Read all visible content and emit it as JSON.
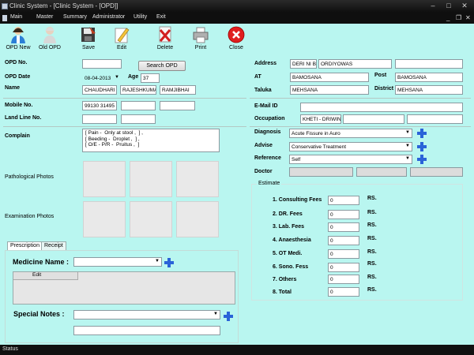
{
  "window": {
    "title": "Clinic System - [Clinic System - [OPD]]",
    "controls": {
      "minimize": "–",
      "maximize": "□",
      "close": "✕"
    },
    "mdi_controls": {
      "minimize": "_",
      "restore": "❒",
      "close": "✕"
    }
  },
  "menu": [
    "Main",
    "Master",
    "Summary",
    "Administrator",
    "Utility",
    "Exit"
  ],
  "toolbar": [
    {
      "label": "OPD New",
      "icon": "person-add-icon"
    },
    {
      "label": "Old OPD",
      "icon": "old-person-icon"
    },
    {
      "label": "Save",
      "icon": "save-icon"
    },
    {
      "label": "Edit",
      "icon": "edit-pencil-icon"
    },
    {
      "label": "Delete",
      "icon": "delete-document-icon"
    },
    {
      "label": "Print",
      "icon": "printer-icon"
    },
    {
      "label": "Close",
      "icon": "close-circle-icon"
    }
  ],
  "form": {
    "opd_no": {
      "label": "OPD No.",
      "value": ""
    },
    "search_opd_button": "Search OPD",
    "opd_date": {
      "label": "OPD Date",
      "value": "08-04-2013"
    },
    "age": {
      "label": "Age",
      "value": "37"
    },
    "name": {
      "label": "Name",
      "first": "CHAUDHARI",
      "middle": "RAJESHKUMA",
      "last": "RAMJIBHAI"
    },
    "mobile": {
      "label": "Mobile No.",
      "value": "99130 31495"
    },
    "landline": {
      "label": "Land Line No."
    },
    "complain": {
      "label": "Complain",
      "lines": [
        "[ Pain -  Only at stool ,  ] ,",
        "[ Beeding -  Droplet ,  ] ,",
        "[ O/E - P/R -  Pruitus ,  ]"
      ]
    },
    "pathological_photos": "Pathological Photos",
    "examination_photos": "Examination Photos",
    "address": {
      "label": "Address",
      "line1": "DERI NI B/",
      "line2": "ORDIYOWAS"
    },
    "at": {
      "label": "AT",
      "value": "BAMOSANA"
    },
    "post": {
      "label": "Post",
      "value": "BAMOSANA"
    },
    "taluka": {
      "label": "Taluka",
      "value": "MEHSANA"
    },
    "district": {
      "label": "District",
      "value": "MEHSANA"
    },
    "email": {
      "label": "E-Mail ID",
      "value": ""
    },
    "occupation": {
      "label": "Occupation",
      "value": "KHETI - DRIWING"
    },
    "diagnosis": {
      "label": "Diagnosis",
      "value": "Acute Fissure in Auro"
    },
    "advise": {
      "label": "Advise",
      "value": "Conservative Treatment"
    },
    "reference": {
      "label": "Reference",
      "value": "Self"
    },
    "doctor": {
      "label": "Doctor"
    }
  },
  "estimate": {
    "title": "Estimate",
    "currency": "RS.",
    "rows": [
      {
        "label": "1.  Consulting Fees",
        "value": "0"
      },
      {
        "label": "2.  DR. Fees",
        "value": "0"
      },
      {
        "label": "3.  Lab. Fees",
        "value": "0"
      },
      {
        "label": "4.  Anaesthesia",
        "value": "0"
      },
      {
        "label": "5.  OT Medi.",
        "value": "0"
      },
      {
        "label": "6.  Sono. Fess",
        "value": "0"
      },
      {
        "label": "7.  Others",
        "value": "0"
      },
      {
        "label": "8.  Total",
        "value": "0"
      }
    ]
  },
  "tabs": [
    "Prescription",
    "Receipt"
  ],
  "prescription": {
    "medicine_label": "Medicine Name :",
    "grid_header": "Edit",
    "special_notes_label": "Special Notes :"
  },
  "status": "Status"
}
